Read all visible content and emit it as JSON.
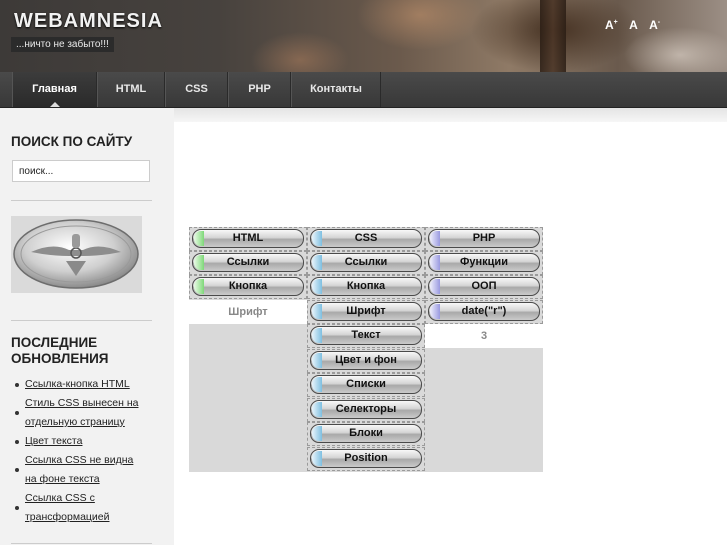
{
  "header": {
    "site_title": "WEBAMNESIA",
    "tagline": "...ничто не забыто!!!",
    "font_tools": [
      {
        "label": "A",
        "sup": "+"
      },
      {
        "label": "A",
        "sup": ""
      },
      {
        "label": "A",
        "sup": "-"
      }
    ]
  },
  "nav": {
    "items": [
      {
        "label": "Главная",
        "active": true
      },
      {
        "label": "HTML"
      },
      {
        "label": "CSS"
      },
      {
        "label": "PHP"
      },
      {
        "label": "Контакты"
      }
    ]
  },
  "sidebar": {
    "search_heading": "ПОИСК ПО САЙТУ",
    "search_value": "поиск...",
    "updates_heading_line1": "ПОСЛЕДНИЕ",
    "updates_heading_line2": "ОБНОВЛЕНИЯ",
    "updates": [
      {
        "line1": "Ссылка-кнопка HTML",
        "line2": ""
      },
      {
        "line1": "Стиль CSS вынесен на",
        "line2": "отдельную страницу"
      },
      {
        "line1": "Цвет текста",
        "line2": ""
      },
      {
        "line1": "Ссылка CSS не видна",
        "line2": "на фоне текста"
      },
      {
        "line1": "Ссылка CSS с",
        "line2": "трансформацией"
      }
    ]
  },
  "menu_grid": {
    "html_column": {
      "buttons": [
        "HTML",
        "Ссылки",
        "Кнопка"
      ],
      "footer_label": "Шрифт"
    },
    "css_column": {
      "buttons": [
        "CSS",
        "Ссылки",
        "Кнопка",
        "Шрифт",
        "Текст",
        "Цвет и фон",
        "Списки",
        "Селекторы",
        "Блоки",
        "Position"
      ]
    },
    "php_column": {
      "buttons": [
        "PHP",
        "Функции",
        "ООП",
        "date(\"r\")"
      ],
      "footer_label": "3"
    }
  },
  "colors": {
    "html_accent": "#7fd879",
    "css_accent": "#7fbfe0",
    "php_accent": "#9a9ae0",
    "grid_bg": "#d9d9d9"
  }
}
